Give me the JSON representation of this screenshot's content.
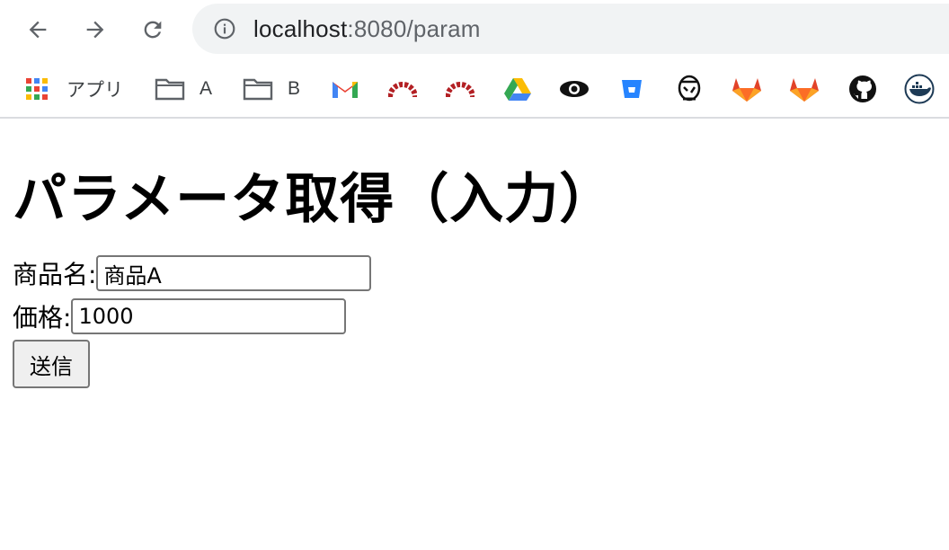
{
  "browser": {
    "url_host": "localhost",
    "url_rest": ":8080/param",
    "bookmarks": {
      "apps_label": "アプリ",
      "folder_a": "A",
      "folder_b": "B"
    }
  },
  "page": {
    "heading": "パラメータ取得（入力）",
    "form": {
      "product_name_label": "商品名:",
      "product_name_value": "商品A",
      "price_label": "価格:",
      "price_value": "1000",
      "submit_label": "送信"
    }
  },
  "icons": [
    "back-arrow-icon",
    "forward-arrow-icon",
    "reload-icon",
    "info-icon",
    "apps-grid-icon",
    "folder-icon",
    "gmail-icon",
    "redmine-icon",
    "google-drive-icon",
    "eye-icon",
    "bitbucket-icon",
    "jenkins-icon",
    "gitlab-icon",
    "github-icon",
    "docker-icon"
  ],
  "colors": {
    "omnibox_bg": "#f1f3f4",
    "button_bg": "#efefef",
    "input_border": "#767676"
  }
}
